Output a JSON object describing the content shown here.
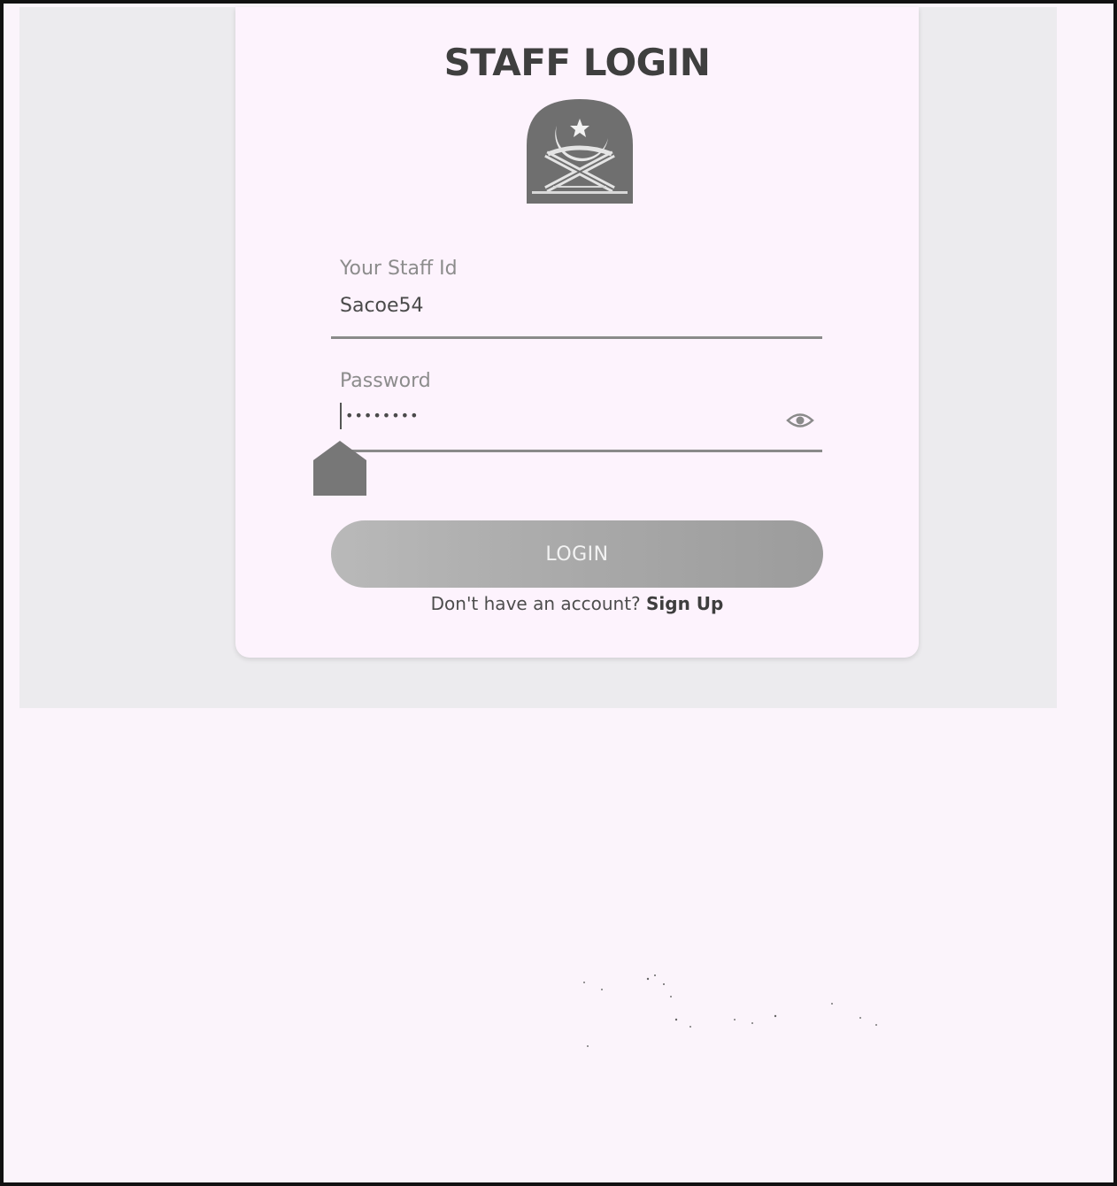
{
  "login": {
    "title": "STAFF LOGIN",
    "staff_id_label": "Your Staff Id",
    "staff_id_value": "Sacoe54",
    "password_label": "Password",
    "password_value": "••••••••",
    "login_button": "LOGIN",
    "signup_prompt": "Don't have an account?",
    "signup_link": "Sign Up"
  },
  "icons": {
    "logo": "emblem-logo-crescent-star",
    "password_toggle": "eye-icon",
    "cursor_handle": "text-cursor-handle"
  },
  "colors": {
    "card_background": "#fdf3fd",
    "page_background": "#fbf4fb",
    "button": "#aaaaaa",
    "title": "#3f3f3f"
  }
}
